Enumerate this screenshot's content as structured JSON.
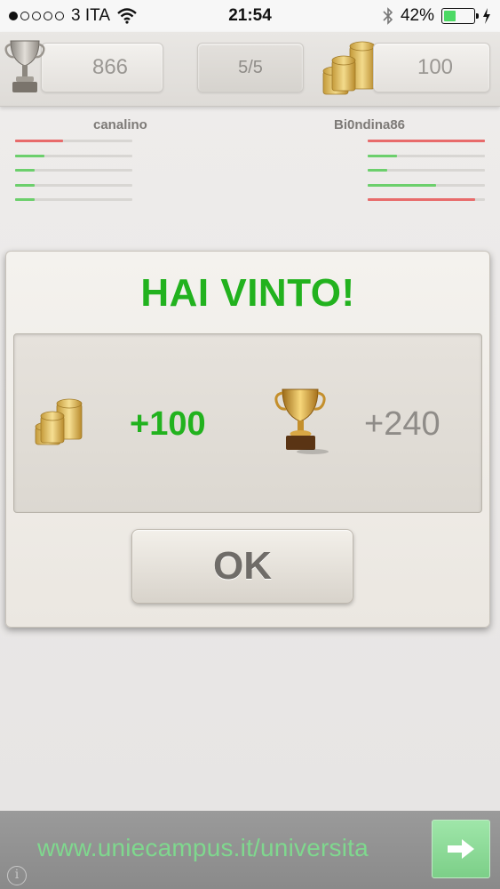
{
  "status_bar": {
    "carrier": "3 ITA",
    "time": "21:54",
    "battery": "42%",
    "battery_level": 0.42,
    "signal_bars": 1,
    "signal_total": 5
  },
  "top_bar": {
    "trophies": "866",
    "round": "5/5",
    "coins": "100"
  },
  "players": {
    "left": {
      "name": "canalino",
      "bars": [
        {
          "fill": 0.41,
          "color": "#e86b6b"
        },
        {
          "fill": 0.25,
          "color": "#6ccf6c"
        },
        {
          "fill": 0.17,
          "color": "#6ccf6c"
        },
        {
          "fill": 0.17,
          "color": "#6ccf6c"
        },
        {
          "fill": 0.17,
          "color": "#6ccf6c"
        }
      ]
    },
    "right": {
      "name": "Bi0ndina86",
      "bars": [
        {
          "fill": 1.0,
          "color": "#e86b6b"
        },
        {
          "fill": 0.25,
          "color": "#6ccf6c"
        },
        {
          "fill": 0.17,
          "color": "#6ccf6c"
        },
        {
          "fill": 0.58,
          "color": "#6ccf6c"
        },
        {
          "fill": 0.92,
          "color": "#e86b6b"
        }
      ]
    }
  },
  "dialog": {
    "title": "HAI VINTO!",
    "coins_reward": "+100",
    "trophies_reward": "+240",
    "ok_label": "OK"
  },
  "ad": {
    "url_text": "www.uniecampus.it/universita",
    "info_glyph": "i"
  },
  "colors": {
    "win_green": "#22b21e",
    "ad_text": "#7fd88e"
  },
  "icons": [
    "signal-dots-icon",
    "wifi-icon",
    "bluetooth-icon",
    "battery-icon",
    "charging-bolt-icon",
    "trophy-icon",
    "coins-icon",
    "info-icon",
    "arrow-right-icon"
  ]
}
